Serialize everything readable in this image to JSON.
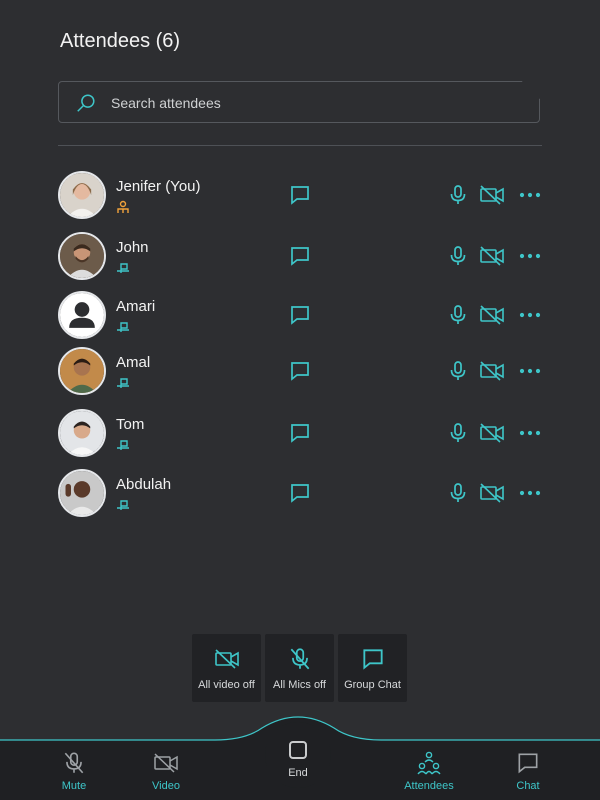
{
  "header": {
    "title": "Attendees (6)"
  },
  "search": {
    "placeholder": "Search attendees",
    "value": ""
  },
  "attendees": [
    {
      "name": "Jenifer (You)",
      "role": "host"
    },
    {
      "name": "John",
      "role": "participant"
    },
    {
      "name": "Amari",
      "role": "participant"
    },
    {
      "name": "Amal",
      "role": "participant"
    },
    {
      "name": "Tom",
      "role": "participant"
    },
    {
      "name": "Abdulah",
      "role": "participant"
    }
  ],
  "quick_actions": {
    "all_video_off": "All video off",
    "all_mics_off": "All Mics off",
    "group_chat": "Group Chat"
  },
  "bottom_nav": {
    "mute": "Mute",
    "video": "Video",
    "end": "End",
    "attendees": "Attendees",
    "chat": "Chat"
  },
  "colors": {
    "accent": "#3ec6c9",
    "host_badge": "#f0a23b",
    "background": "#2d2e31"
  }
}
